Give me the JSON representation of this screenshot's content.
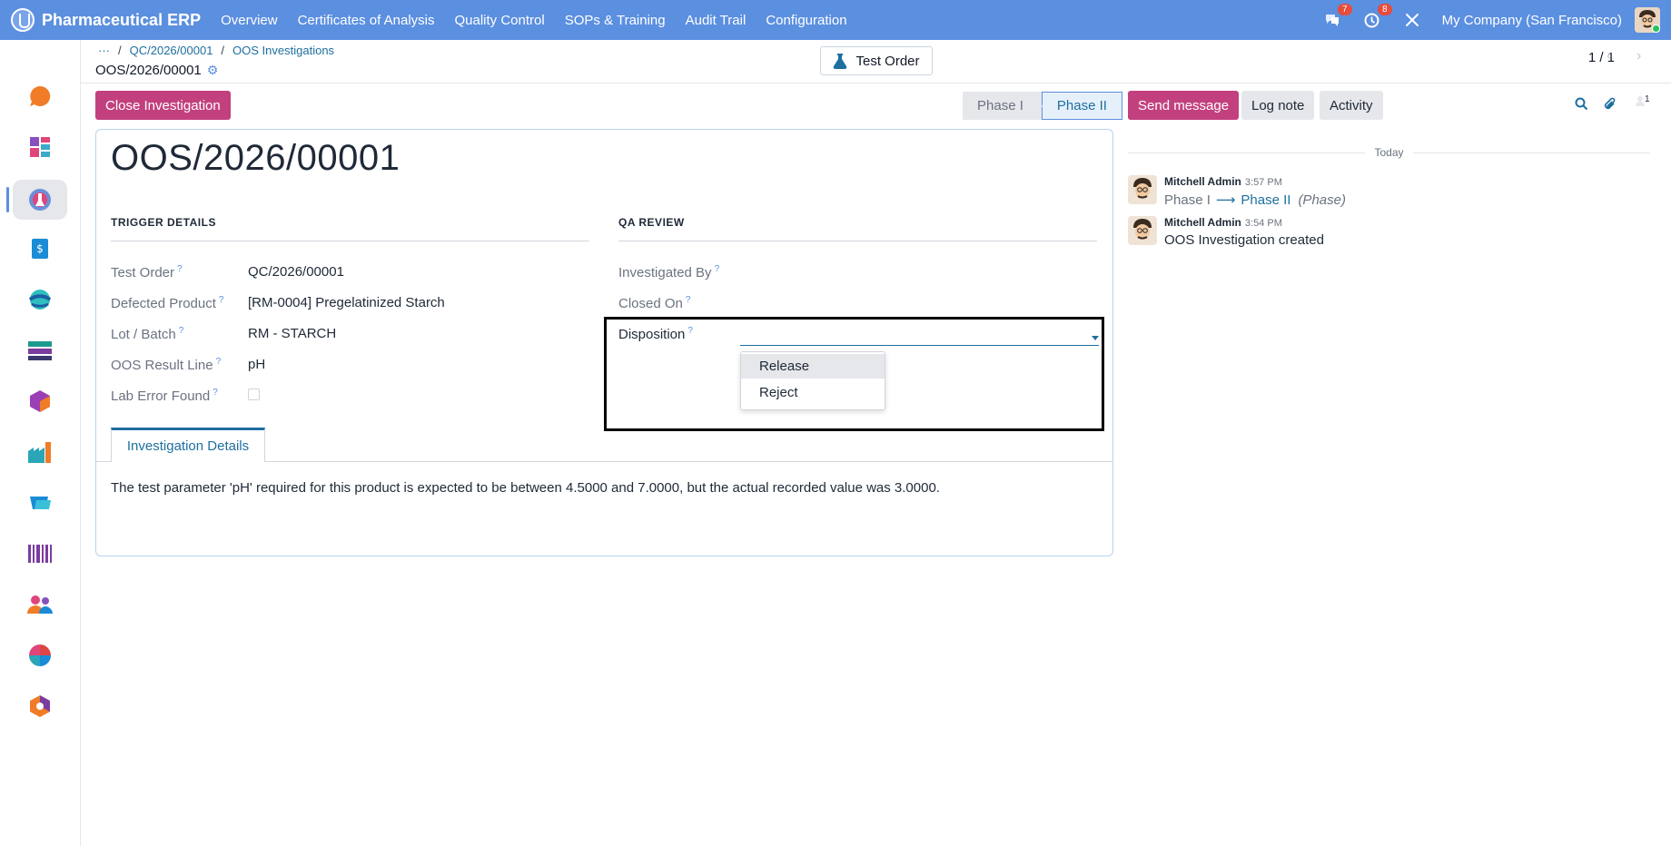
{
  "navbar": {
    "brand": "Pharmaceutical ERP",
    "menu": [
      "Overview",
      "Certificates of Analysis",
      "Quality Control",
      "SOPs & Training",
      "Audit Trail",
      "Configuration"
    ],
    "messages_badge": "7",
    "activities_badge": "8",
    "company": "My Company (San Francisco)",
    "color": "#5b8fe0"
  },
  "breadcrumb": {
    "ellipsis": "···",
    "items": [
      "QC/2026/00001",
      "OOS Investigations"
    ],
    "separator": "/"
  },
  "record": {
    "title": "OOS/2026/00001",
    "smart_button": "Test Order",
    "pager": "1 / 1"
  },
  "form": {
    "close_button": "Close Investigation",
    "phases": [
      "Phase I",
      "Phase II"
    ],
    "current_phase": "Phase II",
    "name": "OOS/2026/00001",
    "trigger_group": "TRIGGER DETAILS",
    "qa_group": "QA REVIEW",
    "fields": {
      "test_order": {
        "label": "Test Order",
        "value": "QC/2026/00001"
      },
      "product": {
        "label": "Defected Product",
        "value": "[RM-0004] Pregelatinized Starch"
      },
      "lot": {
        "label": "Lot / Batch",
        "value": "RM - STARCH"
      },
      "result_line": {
        "label": "OOS Result Line",
        "value": "pH"
      },
      "lab_error": {
        "label": "Lab Error Found",
        "checked": false
      },
      "investigated_by": {
        "label": "Investigated By",
        "value": ""
      },
      "closed_on": {
        "label": "Closed On",
        "value": ""
      },
      "disposition": {
        "label": "Disposition",
        "value": "",
        "options": [
          "Release",
          "Reject"
        ]
      }
    },
    "help_mark": "?",
    "tab": "Investigation Details",
    "details": "The test parameter 'pH' required for this product is expected to be between 4.5000 and 7.0000, but the actual recorded value was 3.0000."
  },
  "chatter": {
    "send_message": "Send message",
    "log_note": "Log note",
    "activity": "Activity",
    "followers_count": "1",
    "today": "Today",
    "messages": [
      {
        "author": "Mitchell Admin",
        "time": "3:57 PM",
        "old": "Phase I",
        "new": "Phase II",
        "field": "(Phase)"
      },
      {
        "author": "Mitchell Admin",
        "time": "3:54 PM",
        "body": "OOS Investigation created"
      }
    ]
  }
}
